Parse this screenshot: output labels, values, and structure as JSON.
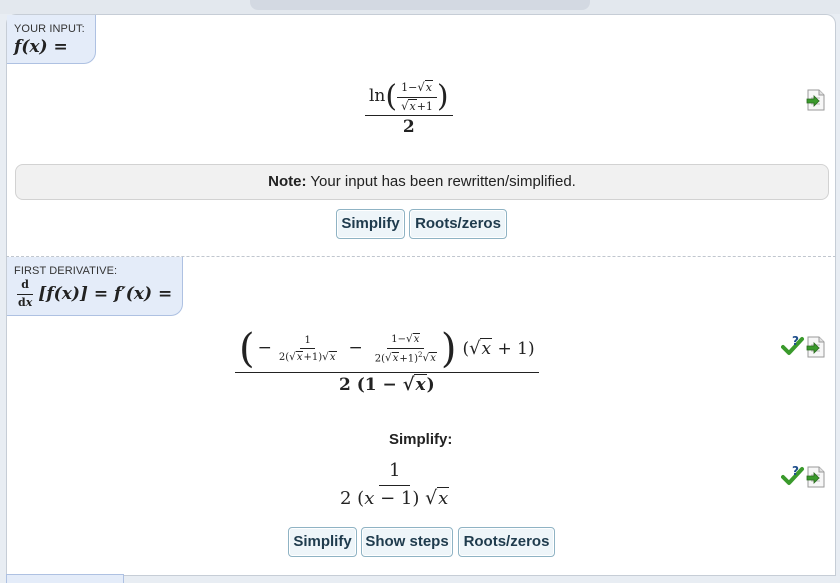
{
  "input_section": {
    "caption": "YOUR INPUT:",
    "lhs": "f(x) =",
    "note_bold": "Note:",
    "note_text": " Your input has been rewritten/simplified.",
    "buttons": [
      "Simplify",
      "Roots/zeros"
    ]
  },
  "derivative_section": {
    "caption": "FIRST DERIVATIVE:",
    "lhs": "d/dx [f(x)] = f′(x) =",
    "simplify_label": "Simplify:",
    "buttons": [
      "Simplify",
      "Show steps",
      "Roots/zeros"
    ]
  },
  "math": {
    "ln": "ln",
    "one": "1",
    "two": "2",
    "minus": "−",
    "plus": "+",
    "x": "x",
    "sq_exp": "2"
  },
  "icons": {
    "open_in_editor": "open-in-editor-icon",
    "check_question": "check-question-icon"
  },
  "colors": {
    "tag_bg": "#e4ecf9",
    "button_text": "#1f3b4d",
    "button_border": "#8fb3c4",
    "check_green": "#3a9a2c"
  }
}
